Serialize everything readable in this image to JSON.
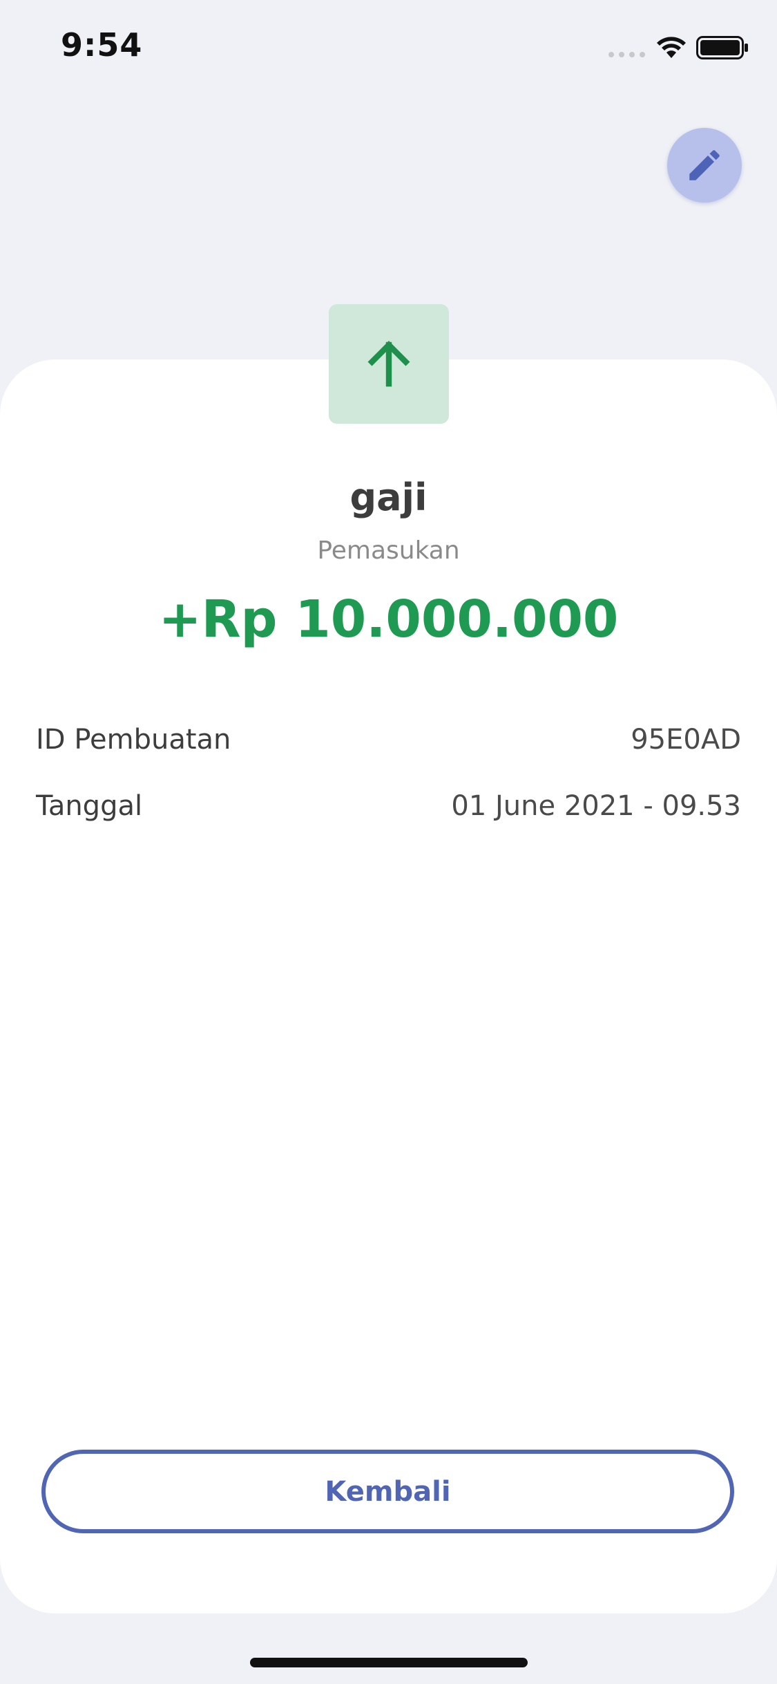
{
  "status_bar": {
    "time": "9:54"
  },
  "header": {
    "edit_icon": "pencil-icon"
  },
  "transaction": {
    "type_icon": "arrow-up-icon",
    "title": "gaji",
    "category": "Pemasukan",
    "amount": "+Rp 10.000.000",
    "amount_color": "#1f9a52"
  },
  "details": [
    {
      "label": "ID Pembuatan",
      "value": "95E0AD"
    },
    {
      "label": "Tanggal",
      "value": "01 June 2021 - 09.53"
    }
  ],
  "actions": {
    "back_label": "Kembali"
  },
  "colors": {
    "accent": "#5066b5",
    "income": "#1f9a52",
    "background": "#f0f1f6"
  }
}
